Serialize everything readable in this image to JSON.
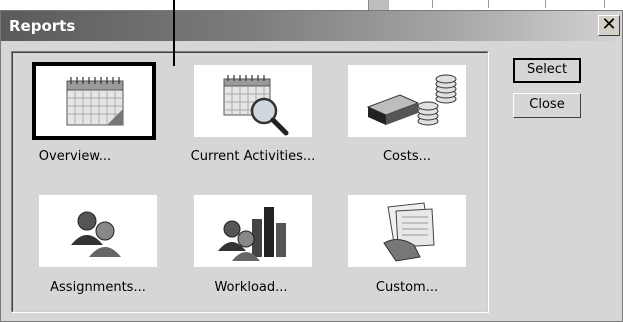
{
  "dialog": {
    "title": "Reports",
    "close_glyph": "✕"
  },
  "buttons": {
    "select_label": "Select",
    "close_label": "Close"
  },
  "reports": [
    {
      "label": "Overview...",
      "icon": "calendar-overview-icon",
      "selected": true
    },
    {
      "label": "Current Activities...",
      "icon": "calendar-magnifier-icon",
      "selected": false
    },
    {
      "label": "Costs...",
      "icon": "money-stacks-icon",
      "selected": false
    },
    {
      "label": "Assignments...",
      "icon": "people-icon",
      "selected": false
    },
    {
      "label": "Workload...",
      "icon": "people-bar-chart-icon",
      "selected": false
    },
    {
      "label": "Custom...",
      "icon": "hand-documents-icon",
      "selected": false
    }
  ]
}
